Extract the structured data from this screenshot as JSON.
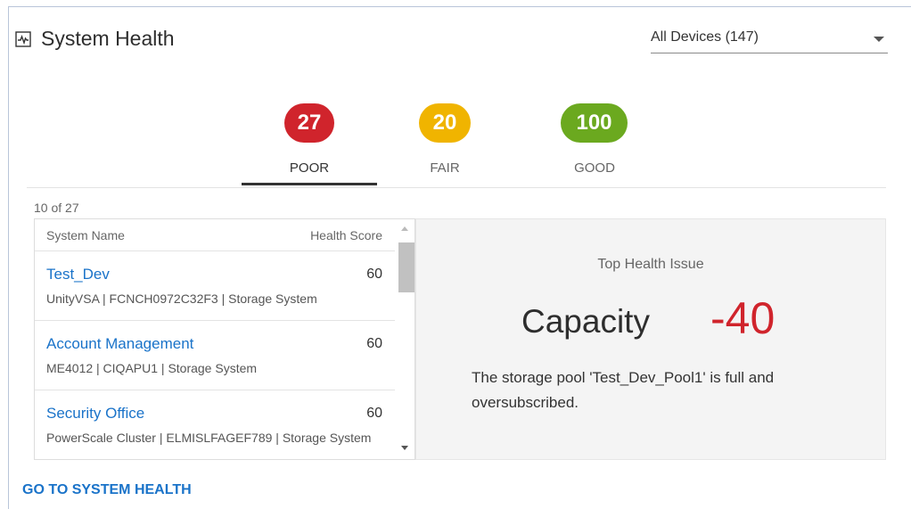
{
  "header": {
    "title": "System Health",
    "title_icon": "pulse-icon",
    "device_filter": "All Devices (147)"
  },
  "colors": {
    "poor": "#d0242c",
    "fair": "#f0b400",
    "good": "#6ba91f",
    "link": "#1a73c9"
  },
  "tabs": [
    {
      "label": "POOR",
      "count": "27",
      "selected": true
    },
    {
      "label": "FAIR",
      "count": "20",
      "selected": false
    },
    {
      "label": "GOOD",
      "count": "100",
      "selected": false
    }
  ],
  "list": {
    "count_text": "10 of 27",
    "columns": {
      "name": "System Name",
      "score": "Health Score"
    },
    "rows": [
      {
        "name": "Test_Dev",
        "score": "60",
        "meta": "UnityVSA | FCNCH0972C32F3 | Storage System"
      },
      {
        "name": "Account Management",
        "score": "60",
        "meta": "ME4012 | CIQAPU1 | Storage System"
      },
      {
        "name": "Security Office",
        "score": "60",
        "meta": "PowerScale Cluster | ELMISLFAGEF789 | Storage System"
      }
    ]
  },
  "detail": {
    "heading": "Top Health Issue",
    "issue": "Capacity",
    "issue_score": "-40",
    "description": "The storage pool 'Test_Dev_Pool1' is full and oversubscribed."
  },
  "footer": {
    "link_label": "GO TO SYSTEM HEALTH"
  }
}
